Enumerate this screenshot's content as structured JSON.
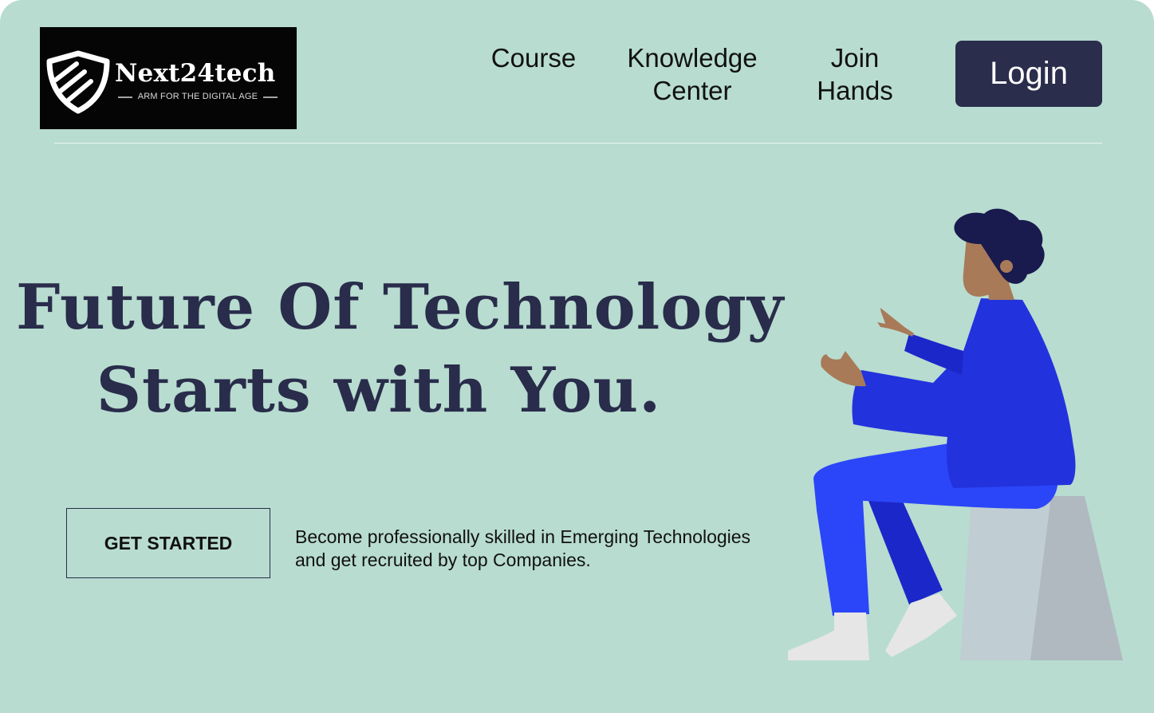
{
  "header": {
    "logo": {
      "name": "Next24tech",
      "tagline": "ARM FOR THE DIGITAL AGE",
      "icon": "shield-icon"
    },
    "nav": {
      "course": "Course",
      "knowledge_line1": "Knowledge",
      "knowledge_line2": "Center",
      "join_line1": "Join",
      "join_line2": "Hands"
    },
    "login_label": "Login"
  },
  "hero": {
    "headline_line1": "Future Of Technology",
    "headline_line2": "Starts with You.",
    "cta_label": "GET STARTED",
    "description_line1": "Become professionally skilled in Emerging Technologies",
    "description_line2": "and get recruited by top Companies.",
    "illustration": "person-sitting-illustration"
  },
  "colors": {
    "background": "#b8dcd0",
    "primary_dark": "#2a2d4b",
    "logo_background": "#050505",
    "illustration_blue": "#2233dd"
  }
}
